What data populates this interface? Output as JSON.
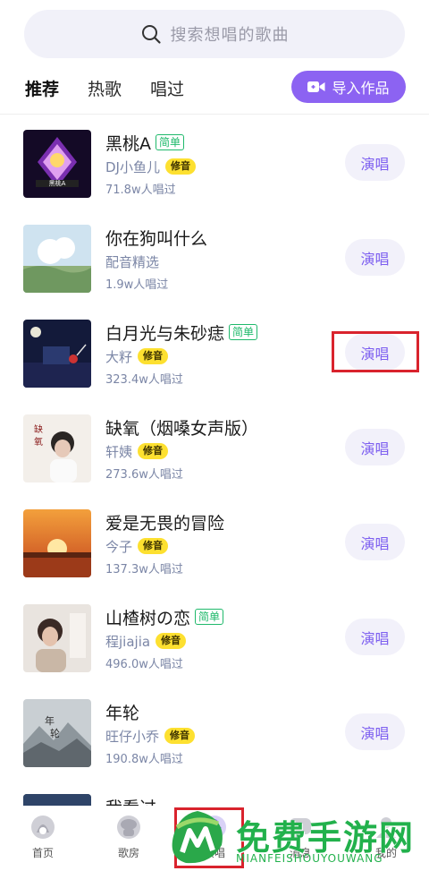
{
  "search": {
    "placeholder": "搜索想唱的歌曲",
    "icon": "search-icon"
  },
  "tabs": [
    {
      "label": "推荐",
      "active": true
    },
    {
      "label": "热歌",
      "active": false
    },
    {
      "label": "唱过",
      "active": false
    }
  ],
  "import_button": {
    "label": "导入作品",
    "icon": "video-camera-icon"
  },
  "accent_color": "#8c63f2",
  "songs": [
    {
      "title": "黑桃A",
      "tag": "简单",
      "artist": "DJ小鱼儿",
      "badge": "修音",
      "plays": "71.8w人唱过",
      "button": "演唱"
    },
    {
      "title": "你在狗叫什么",
      "tag": "",
      "artist": "配音精选",
      "badge": "",
      "plays": "1.9w人唱过",
      "button": "演唱"
    },
    {
      "title": "白月光与朱砂痣",
      "tag": "简单",
      "artist": "大籽",
      "badge": "修音",
      "plays": "323.4w人唱过",
      "button": "演唱"
    },
    {
      "title": "缺氧（烟嗓女声版）",
      "tag": "",
      "artist": "轩姨",
      "badge": "修音",
      "plays": "273.6w人唱过",
      "button": "演唱"
    },
    {
      "title": "爱是无畏的冒险",
      "tag": "",
      "artist": "今子",
      "badge": "修音",
      "plays": "137.3w人唱过",
      "button": "演唱"
    },
    {
      "title": "山楂树の恋",
      "tag": "简单",
      "artist": "程jiajia",
      "badge": "修音",
      "plays": "496.0w人唱过",
      "button": "演唱"
    },
    {
      "title": "年轮",
      "tag": "",
      "artist": "旺仔小乔",
      "badge": "修音",
      "plays": "190.8w人唱过",
      "button": "演唱"
    },
    {
      "title": "我看过",
      "tag": "",
      "artist": "",
      "badge": "",
      "plays": "",
      "button": ""
    }
  ],
  "bottom_nav": [
    {
      "label": "首页",
      "icon": "home-icon"
    },
    {
      "label": "歌房",
      "icon": "room-icon"
    },
    {
      "label": "演唱",
      "icon": "sing-icon"
    },
    {
      "label": "消息",
      "icon": "message-icon"
    },
    {
      "label": "我的",
      "icon": "profile-icon"
    }
  ],
  "watermark": {
    "text": "免费手游网",
    "subtext": "MIANFEISHOUYOUWANG"
  }
}
